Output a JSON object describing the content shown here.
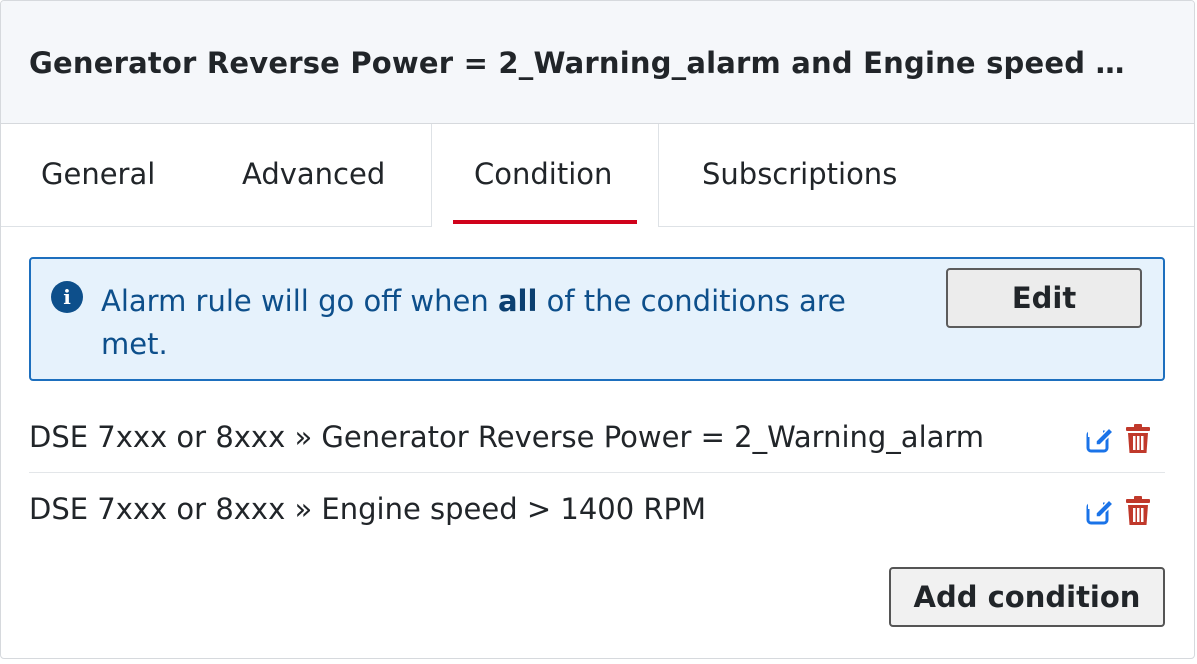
{
  "header": {
    "title": "Generator Reverse Power = 2_Warning_alarm and Engine speed …"
  },
  "tabs": [
    {
      "label": "General"
    },
    {
      "label": "Advanced"
    },
    {
      "label": "Condition",
      "active": true
    },
    {
      "label": "Subscriptions"
    }
  ],
  "info": {
    "icon": "info-circle-icon",
    "text_before": "Alarm rule will go off when ",
    "text_bold": "all",
    "text_after": " of the conditions are met.",
    "edit_label": "Edit"
  },
  "conditions": [
    {
      "text": "DSE 7xxx or 8xxx » Generator Reverse Power = 2_Warning_alarm",
      "edit_icon": "edit-icon",
      "delete_icon": "trash-icon"
    },
    {
      "text": "DSE 7xxx or 8xxx » Engine speed > 1400 RPM",
      "edit_icon": "edit-icon",
      "delete_icon": "trash-icon"
    }
  ],
  "actions": {
    "add_condition_label": "Add condition"
  },
  "colors": {
    "accent_tab": "#d0021b",
    "info_border": "#1d6fbe",
    "info_bg": "#e6f2fc",
    "info_text": "#0d4f8b",
    "edit_icon": "#1a73e8",
    "delete_icon": "#c0392b"
  }
}
